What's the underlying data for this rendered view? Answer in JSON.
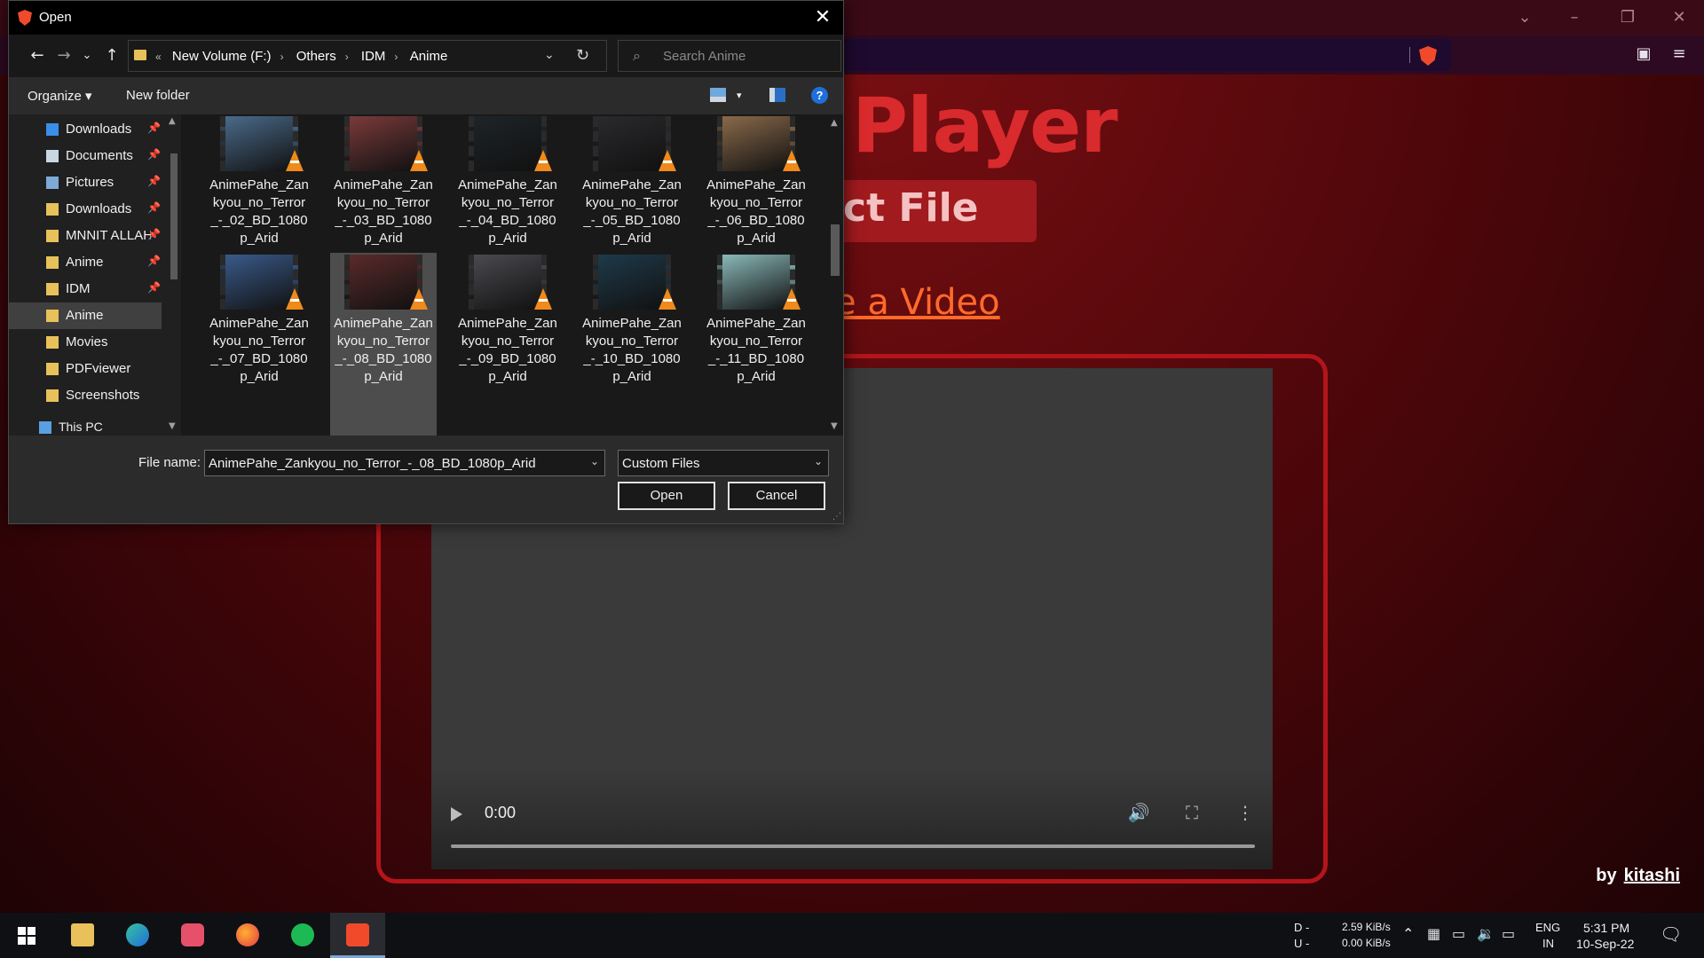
{
  "browser": {
    "page_title": "Player",
    "select_button": "ct File",
    "video_link": "e a Video",
    "video": {
      "time": "0:00"
    },
    "byline_prefix": "by",
    "byline_author": "kitashi"
  },
  "dialog": {
    "title": "Open",
    "breadcrumb": [
      "New Volume (F:)",
      "Others",
      "IDM",
      "Anime"
    ],
    "breadcrumb_overflow": "«",
    "search_placeholder": "Search Anime",
    "organize_label": "Organize ▾",
    "new_folder_label": "New folder",
    "nav_items": [
      {
        "label": "Downloads",
        "icon": "download-arrow-icon",
        "pinned": true
      },
      {
        "label": "Documents",
        "icon": "documents-icon",
        "pinned": true
      },
      {
        "label": "Pictures",
        "icon": "pictures-icon",
        "pinned": true
      },
      {
        "label": "Downloads",
        "icon": "folder-icon",
        "pinned": true
      },
      {
        "label": "MNNIT ALLAH",
        "icon": "folder-icon",
        "pinned": true
      },
      {
        "label": "Anime",
        "icon": "folder-icon",
        "pinned": true
      },
      {
        "label": "IDM",
        "icon": "folder-icon",
        "pinned": true
      },
      {
        "label": "Anime",
        "icon": "folder-icon",
        "pinned": false,
        "selected": true
      },
      {
        "label": "Movies",
        "icon": "folder-icon",
        "pinned": false
      },
      {
        "label": "PDFviewer",
        "icon": "folder-icon",
        "pinned": false
      },
      {
        "label": "Screenshots",
        "icon": "folder-icon",
        "pinned": false
      },
      {
        "label": "This PC",
        "icon": "computer-icon",
        "pinned": false
      }
    ],
    "files": [
      {
        "name": "AnimePahe_Zankyou_no_Terror_-_02_BD_1080p_Arid",
        "thumb": "#4a6a8a"
      },
      {
        "name": "AnimePahe_Zankyou_no_Terror_-_03_BD_1080p_Arid",
        "thumb": "#7a3a3a"
      },
      {
        "name": "AnimePahe_Zankyou_no_Terror_-_04_BD_1080p_Arid",
        "thumb": "#1e2428"
      },
      {
        "name": "AnimePahe_Zankyou_no_Terror_-_05_BD_1080p_Arid",
        "thumb": "#2a2a2e"
      },
      {
        "name": "AnimePahe_Zankyou_no_Terror_-_06_BD_1080p_Arid",
        "thumb": "#8a6a4a"
      },
      {
        "name": "AnimePahe_Zankyou_no_Terror_-_07_BD_1080p_Arid",
        "thumb": "#3a5a8a"
      },
      {
        "name": "AnimePahe_Zankyou_no_Terror_-_08_BD_1080p_Arid",
        "thumb": "#5a2a2a",
        "selected": true
      },
      {
        "name": "AnimePahe_Zankyou_no_Terror_-_09_BD_1080p_Arid",
        "thumb": "#4a4a50"
      },
      {
        "name": "AnimePahe_Zankyou_no_Terror_-_10_BD_1080p_Arid",
        "thumb": "#1e3a4a"
      },
      {
        "name": "AnimePahe_Zankyou_no_Terror_-_11_BD_1080p_Arid",
        "thumb": "#8ab8b8"
      }
    ],
    "file_name_label": "File name:",
    "file_name_value": "AnimePahe_Zankyou_no_Terror_-_08_BD_1080p_Arid",
    "file_type": "Custom Files",
    "open_button": "Open",
    "cancel_button": "Cancel"
  },
  "taskbar": {
    "net_down_label": "D -",
    "net_up_label": "U -",
    "net_down": "2.59 KiB/s",
    "net_up": "0.00 KiB/s",
    "lang": "ENG",
    "region": "IN",
    "time": "5:31 PM",
    "date": "10-Sep-22"
  },
  "colors": {
    "accent_red": "#d92a2d",
    "link_orange": "#ff6a2b",
    "vlc_orange": "#f08a1a",
    "folder_yellow": "#e8c15a"
  }
}
